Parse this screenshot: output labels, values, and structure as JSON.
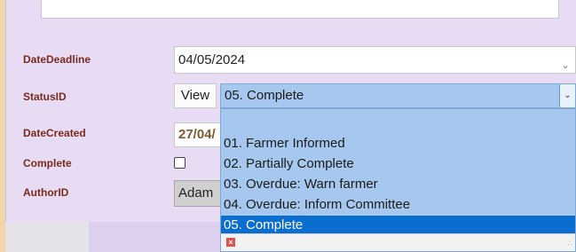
{
  "form": {
    "date_deadline": {
      "label": "DateDeadline",
      "value": "04/05/2024"
    },
    "status": {
      "label": "StatusID",
      "view_button": "View",
      "selected": "05. Complete"
    },
    "date_created": {
      "label": "DateCreated",
      "value": "27/04/"
    },
    "complete": {
      "label": "Complete",
      "checked": false
    },
    "author": {
      "label": "AuthorID",
      "value": "Adam"
    }
  },
  "status_options": [
    "01. Farmer Informed",
    "02. Partially Complete",
    "03. Overdue: Warn farmer",
    "04. Overdue: Inform Committee",
    "05. Complete"
  ],
  "colors": {
    "label": "#7a2a1d",
    "highlight": "#0a6ed1",
    "dropdown_bg": "#a6c8ee",
    "panel_bg": "#e8dcf5"
  }
}
